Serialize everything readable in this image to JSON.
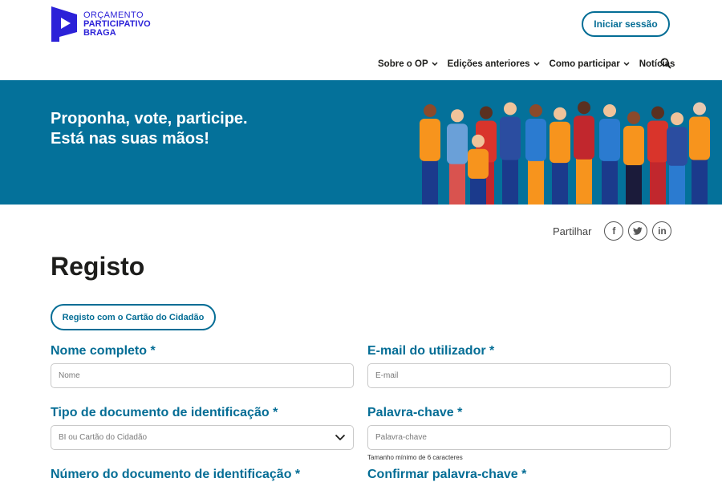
{
  "logo": {
    "line1": "ORÇAMENTO",
    "line2": "PARTICIPATIVO",
    "line3": "BRAGA",
    "color": "#2c22d8"
  },
  "header": {
    "login_label": "Iniciar sessão",
    "nav": [
      {
        "label": "Sobre o OP",
        "dropdown": true
      },
      {
        "label": "Edições anteriores",
        "dropdown": true
      },
      {
        "label": "Como participar",
        "dropdown": true
      },
      {
        "label": "Notícias",
        "dropdown": false
      }
    ],
    "search_icon": "search-icon"
  },
  "hero": {
    "line1": "Proponha, vote, participe.",
    "line2": "Está nas suas mãos!",
    "background": "#04719a"
  },
  "share": {
    "label": "Partilhar",
    "facebook": "f",
    "twitter_icon": "twitter-icon",
    "linkedin": "in"
  },
  "form": {
    "title": "Registo",
    "cc_button": "Registo com o Cartão do Cidadão",
    "fields": {
      "name_label": "Nome completo *",
      "name_placeholder": "Nome",
      "email_label": "E-mail do utilizador *",
      "email_placeholder": "E-mail",
      "doc_type_label": "Tipo de documento de identificação *",
      "doc_type_value": "BI ou Cartão do Cidadão",
      "password_label": "Palavra-chave *",
      "password_placeholder": "Palavra-chave",
      "password_hint": "Tamanho mínimo de 6 caracteres",
      "doc_number_label": "Número do documento de identificação *",
      "confirm_label": "Confirmar palavra-chave *"
    },
    "accent": "#046d95"
  }
}
